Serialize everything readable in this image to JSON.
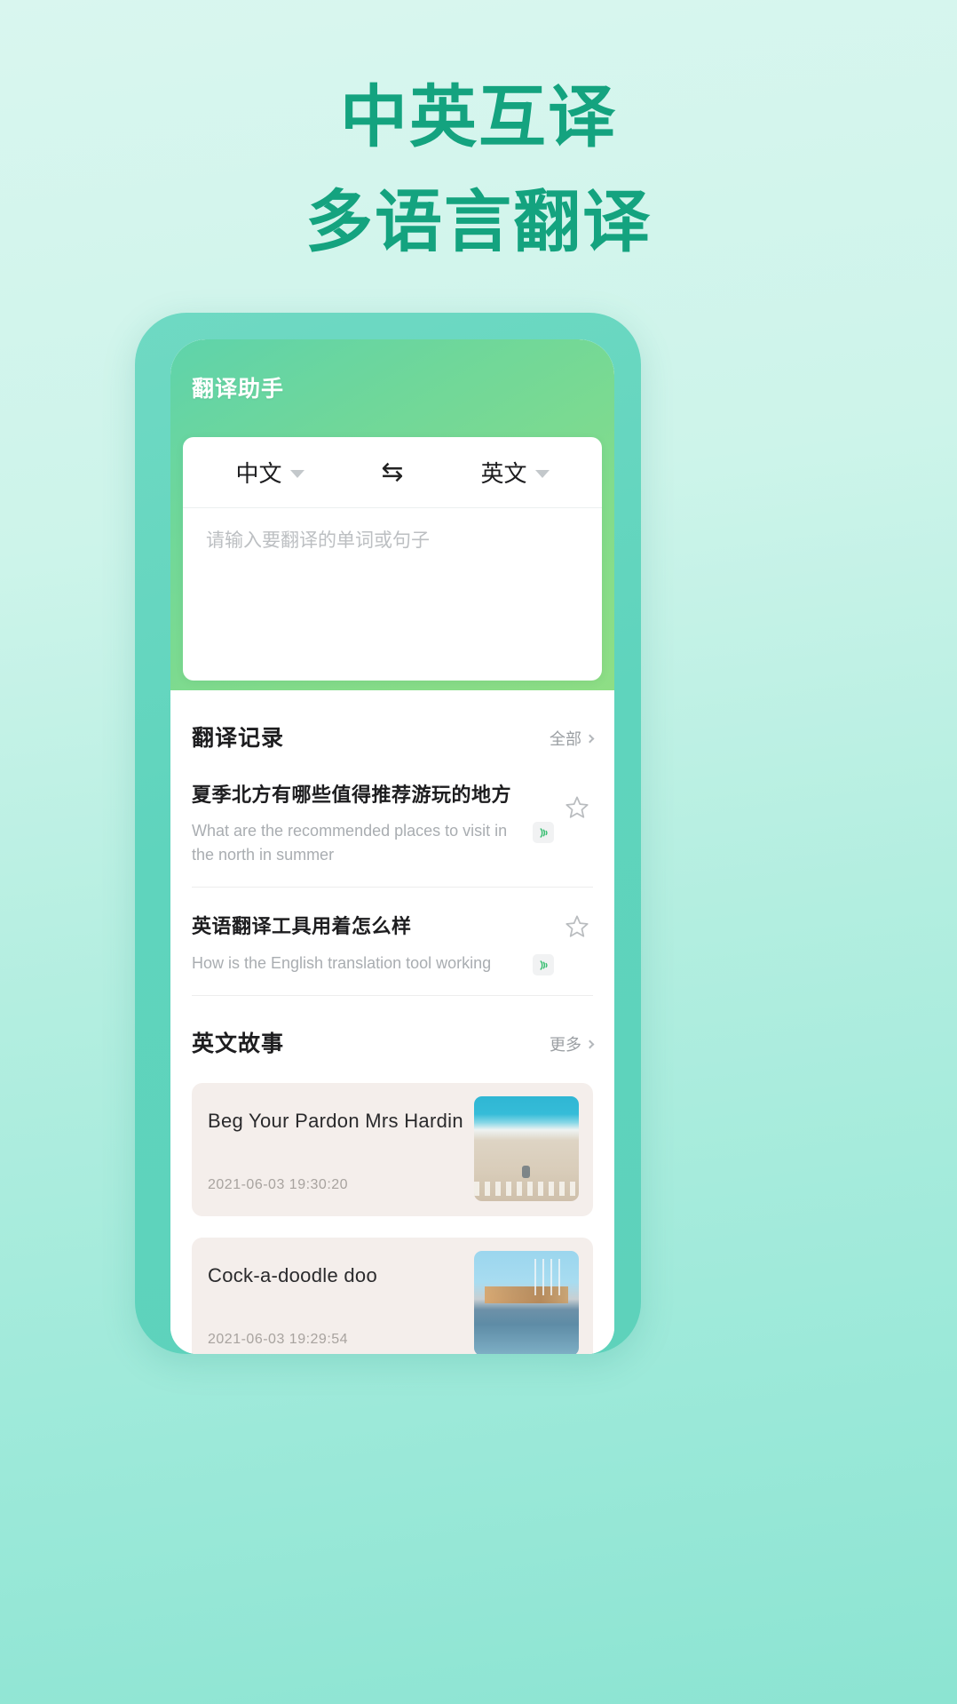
{
  "promo": {
    "line1": "中英互译",
    "line2": "多语言翻译",
    "accent_color": "#14a37f",
    "background_color": "#cdf4ea"
  },
  "app": {
    "title": "翻译助手",
    "appbar_gradient_from": "#5fd3ab",
    "appbar_gradient_to": "#8ede85",
    "frame_color": "#5fd4bd"
  },
  "translate_card": {
    "source_language": "中文",
    "target_language": "英文",
    "swap_icon": "⇆",
    "input_placeholder": "请输入要翻译的单词或句子",
    "input_value": ""
  },
  "history_section": {
    "title": "翻译记录",
    "more_label": "全部",
    "items": [
      {
        "source": "夏季北方有哪些值得推荐游玩的地方",
        "target": "What are the recommended places to visit in the north in summer",
        "speaker_icon": "speaker-icon",
        "favorite_icon": "star-outline-icon",
        "favorited": false
      },
      {
        "source": "英语翻译工具用着怎么样",
        "target": "How is the English translation tool working",
        "speaker_icon": "speaker-icon",
        "favorite_icon": "star-outline-icon",
        "favorited": false
      }
    ]
  },
  "stories_section": {
    "title": "英文故事",
    "more_label": "更多",
    "items": [
      {
        "title": "Beg Your Pardon Mrs Hardin",
        "time": "2021-06-03 19:30:20",
        "thumb": "beach-photo"
      },
      {
        "title": "Cock-a-doodle doo",
        "time": "2021-06-03 19:29:54",
        "thumb": "harbor-photo"
      }
    ]
  },
  "colors": {
    "speaker_green": "#3cbf74",
    "card_bg": "#f4eeeb",
    "muted_text": "#a9adb1"
  }
}
